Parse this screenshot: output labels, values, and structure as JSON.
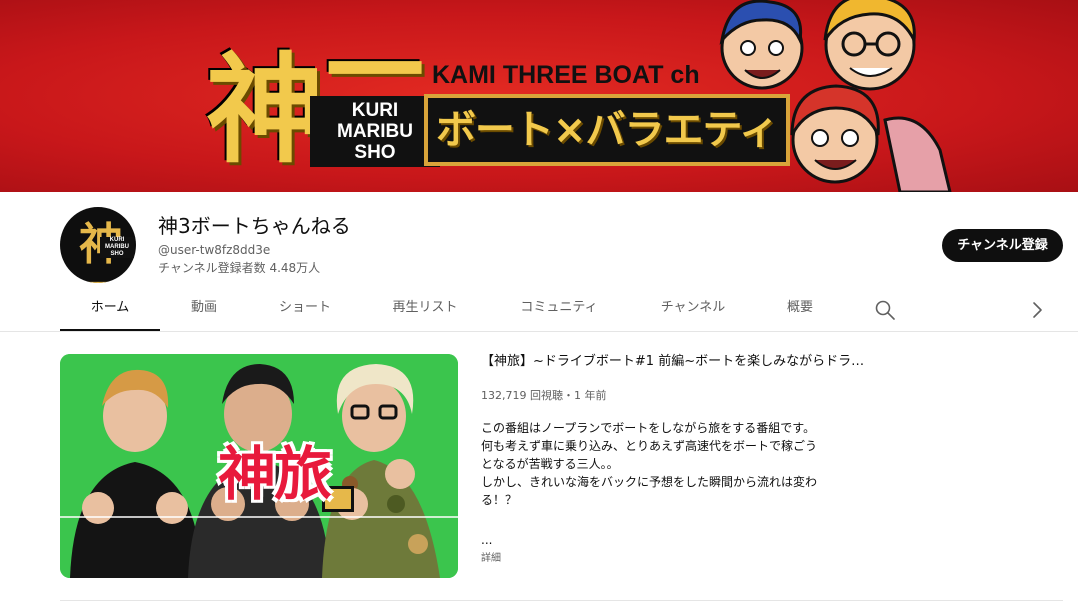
{
  "banner": {
    "logo_kanji": "神三",
    "logo_subtext": "KURI MARIBU SHO",
    "title_top": "KAMI THREE BOAT ch",
    "title_main": "ボート×バラエティ"
  },
  "channel": {
    "name": "神3ボートちゃんねる",
    "handle": "@user-tw8fz8dd3e",
    "subscribers": "チャンネル登録者数 4.48万人",
    "subscribe_label": "チャンネル登録",
    "avatar_kanji": "神三",
    "avatar_subtext": "KURI MARIBU SHO"
  },
  "tabs": [
    {
      "label": "ホーム",
      "active": true
    },
    {
      "label": "動画",
      "active": false
    },
    {
      "label": "ショート",
      "active": false
    },
    {
      "label": "再生リスト",
      "active": false
    },
    {
      "label": "コミュニティ",
      "active": false
    },
    {
      "label": "チャンネル",
      "active": false
    },
    {
      "label": "概要",
      "active": false
    }
  ],
  "icons": {
    "search": "search-icon",
    "next": "chevron-right-icon"
  },
  "featured_video": {
    "thumbnail_text": "神旅",
    "title": "【神旅】~ドライブボート#1 前編~ボートを楽しみながらドラ…",
    "meta": "132,719 回視聴・1 年前",
    "description_lines": [
      "この番組はノープランでボートをしながら旅をする番組です。",
      "何も考えず車に乗り込み、とりあえず高速代をボートで稼ごう",
      "となるが苦戦する三人。。",
      "しかし、きれいな海をバックに予想をした瞬間から流れは変わ",
      "る！？"
    ],
    "ellipsis": "...",
    "more_label": "詳細"
  },
  "colors": {
    "banner_red": "#c8171a",
    "gold": "#f2c94c",
    "thumbnail_green": "#39c44a",
    "subscribe_bg": "#0f0f0f"
  }
}
